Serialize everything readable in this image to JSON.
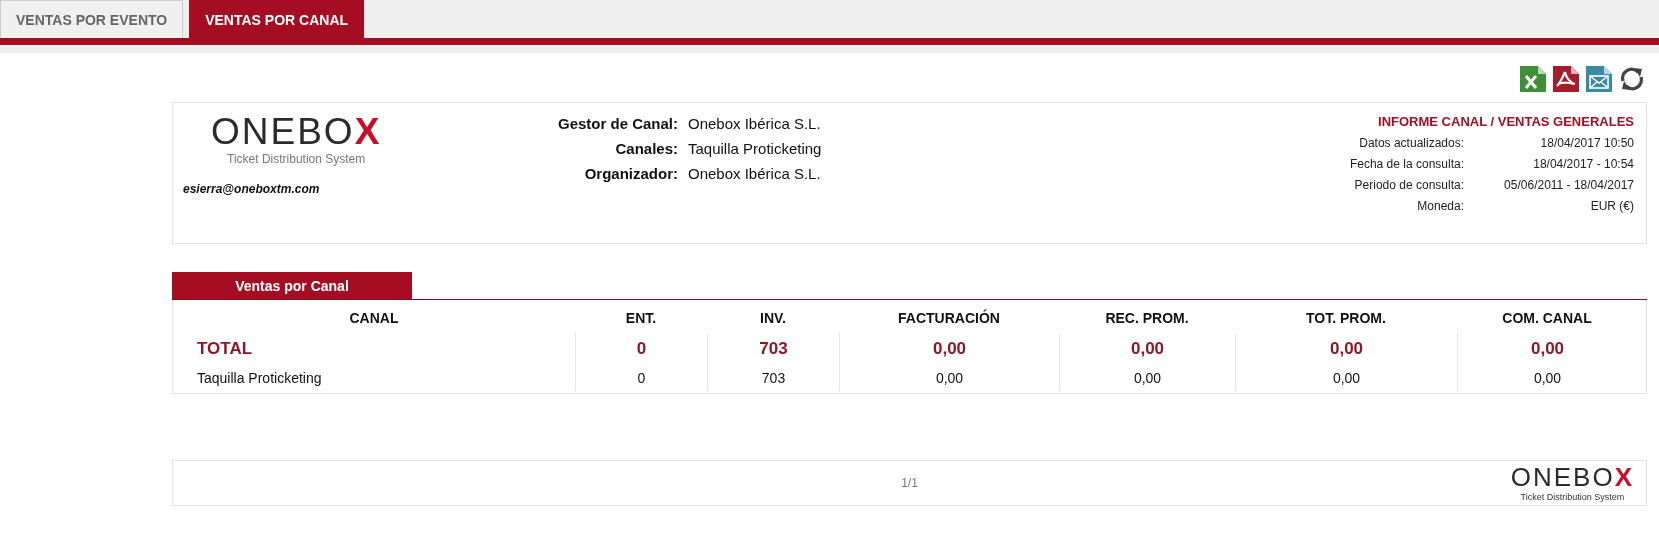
{
  "tabs": [
    {
      "label": "VENTAS POR EVENTO",
      "selected": false
    },
    {
      "label": "VENTAS POR CANAL",
      "selected": true
    }
  ],
  "toolbar": [
    {
      "kind": "excel"
    },
    {
      "kind": "pdf"
    },
    {
      "kind": "email"
    },
    {
      "kind": "refresh"
    }
  ],
  "header": {
    "logo": {
      "name": "ONEBO",
      "mark": "X",
      "tagline": "Ticket Distribution System"
    },
    "email": "esierra@oneboxtm.com",
    "fields": [
      {
        "label": "Gestor de Canal:",
        "value": "Onebox Ibérica S.L."
      },
      {
        "label": "Canales:",
        "value": "Taquilla Proticketing"
      },
      {
        "label": "Organizador:",
        "value": "Onebox Ibérica S.L."
      }
    ],
    "report_title": "INFORME CANAL / VENTAS GENERALES",
    "details": [
      {
        "label": "Datos actualizados:",
        "value": "18/04/2017 10:50"
      },
      {
        "label": "Fecha de la consulta:",
        "value": "18/04/2017 - 10:54"
      },
      {
        "label": "Periodo de consulta:",
        "value": "05/06/2011 - 18/04/2017"
      },
      {
        "label": "Moneda:",
        "value": "EUR (€)"
      }
    ]
  },
  "section_title": "Ventas por Canal",
  "table": {
    "columns": [
      "CANAL",
      "ENT.",
      "INV.",
      "FACTURACIÓN",
      "REC. PROM.",
      "TOT. PROM.",
      "COM. CANAL"
    ],
    "rows": [
      {
        "kind": "total",
        "cells": [
          "TOTAL",
          "0",
          "703",
          "0,00",
          "0,00",
          "0,00",
          "0,00"
        ]
      },
      {
        "kind": "detail",
        "cells": [
          "Taquilla Proticketing",
          "0",
          "703",
          "0,00",
          "0,00",
          "0,00",
          "0,00"
        ]
      }
    ]
  },
  "footer": {
    "page": "1/1",
    "logo": {
      "name": "ONEBO",
      "mark": "X",
      "tagline": "Ticket Distribution System"
    }
  }
}
